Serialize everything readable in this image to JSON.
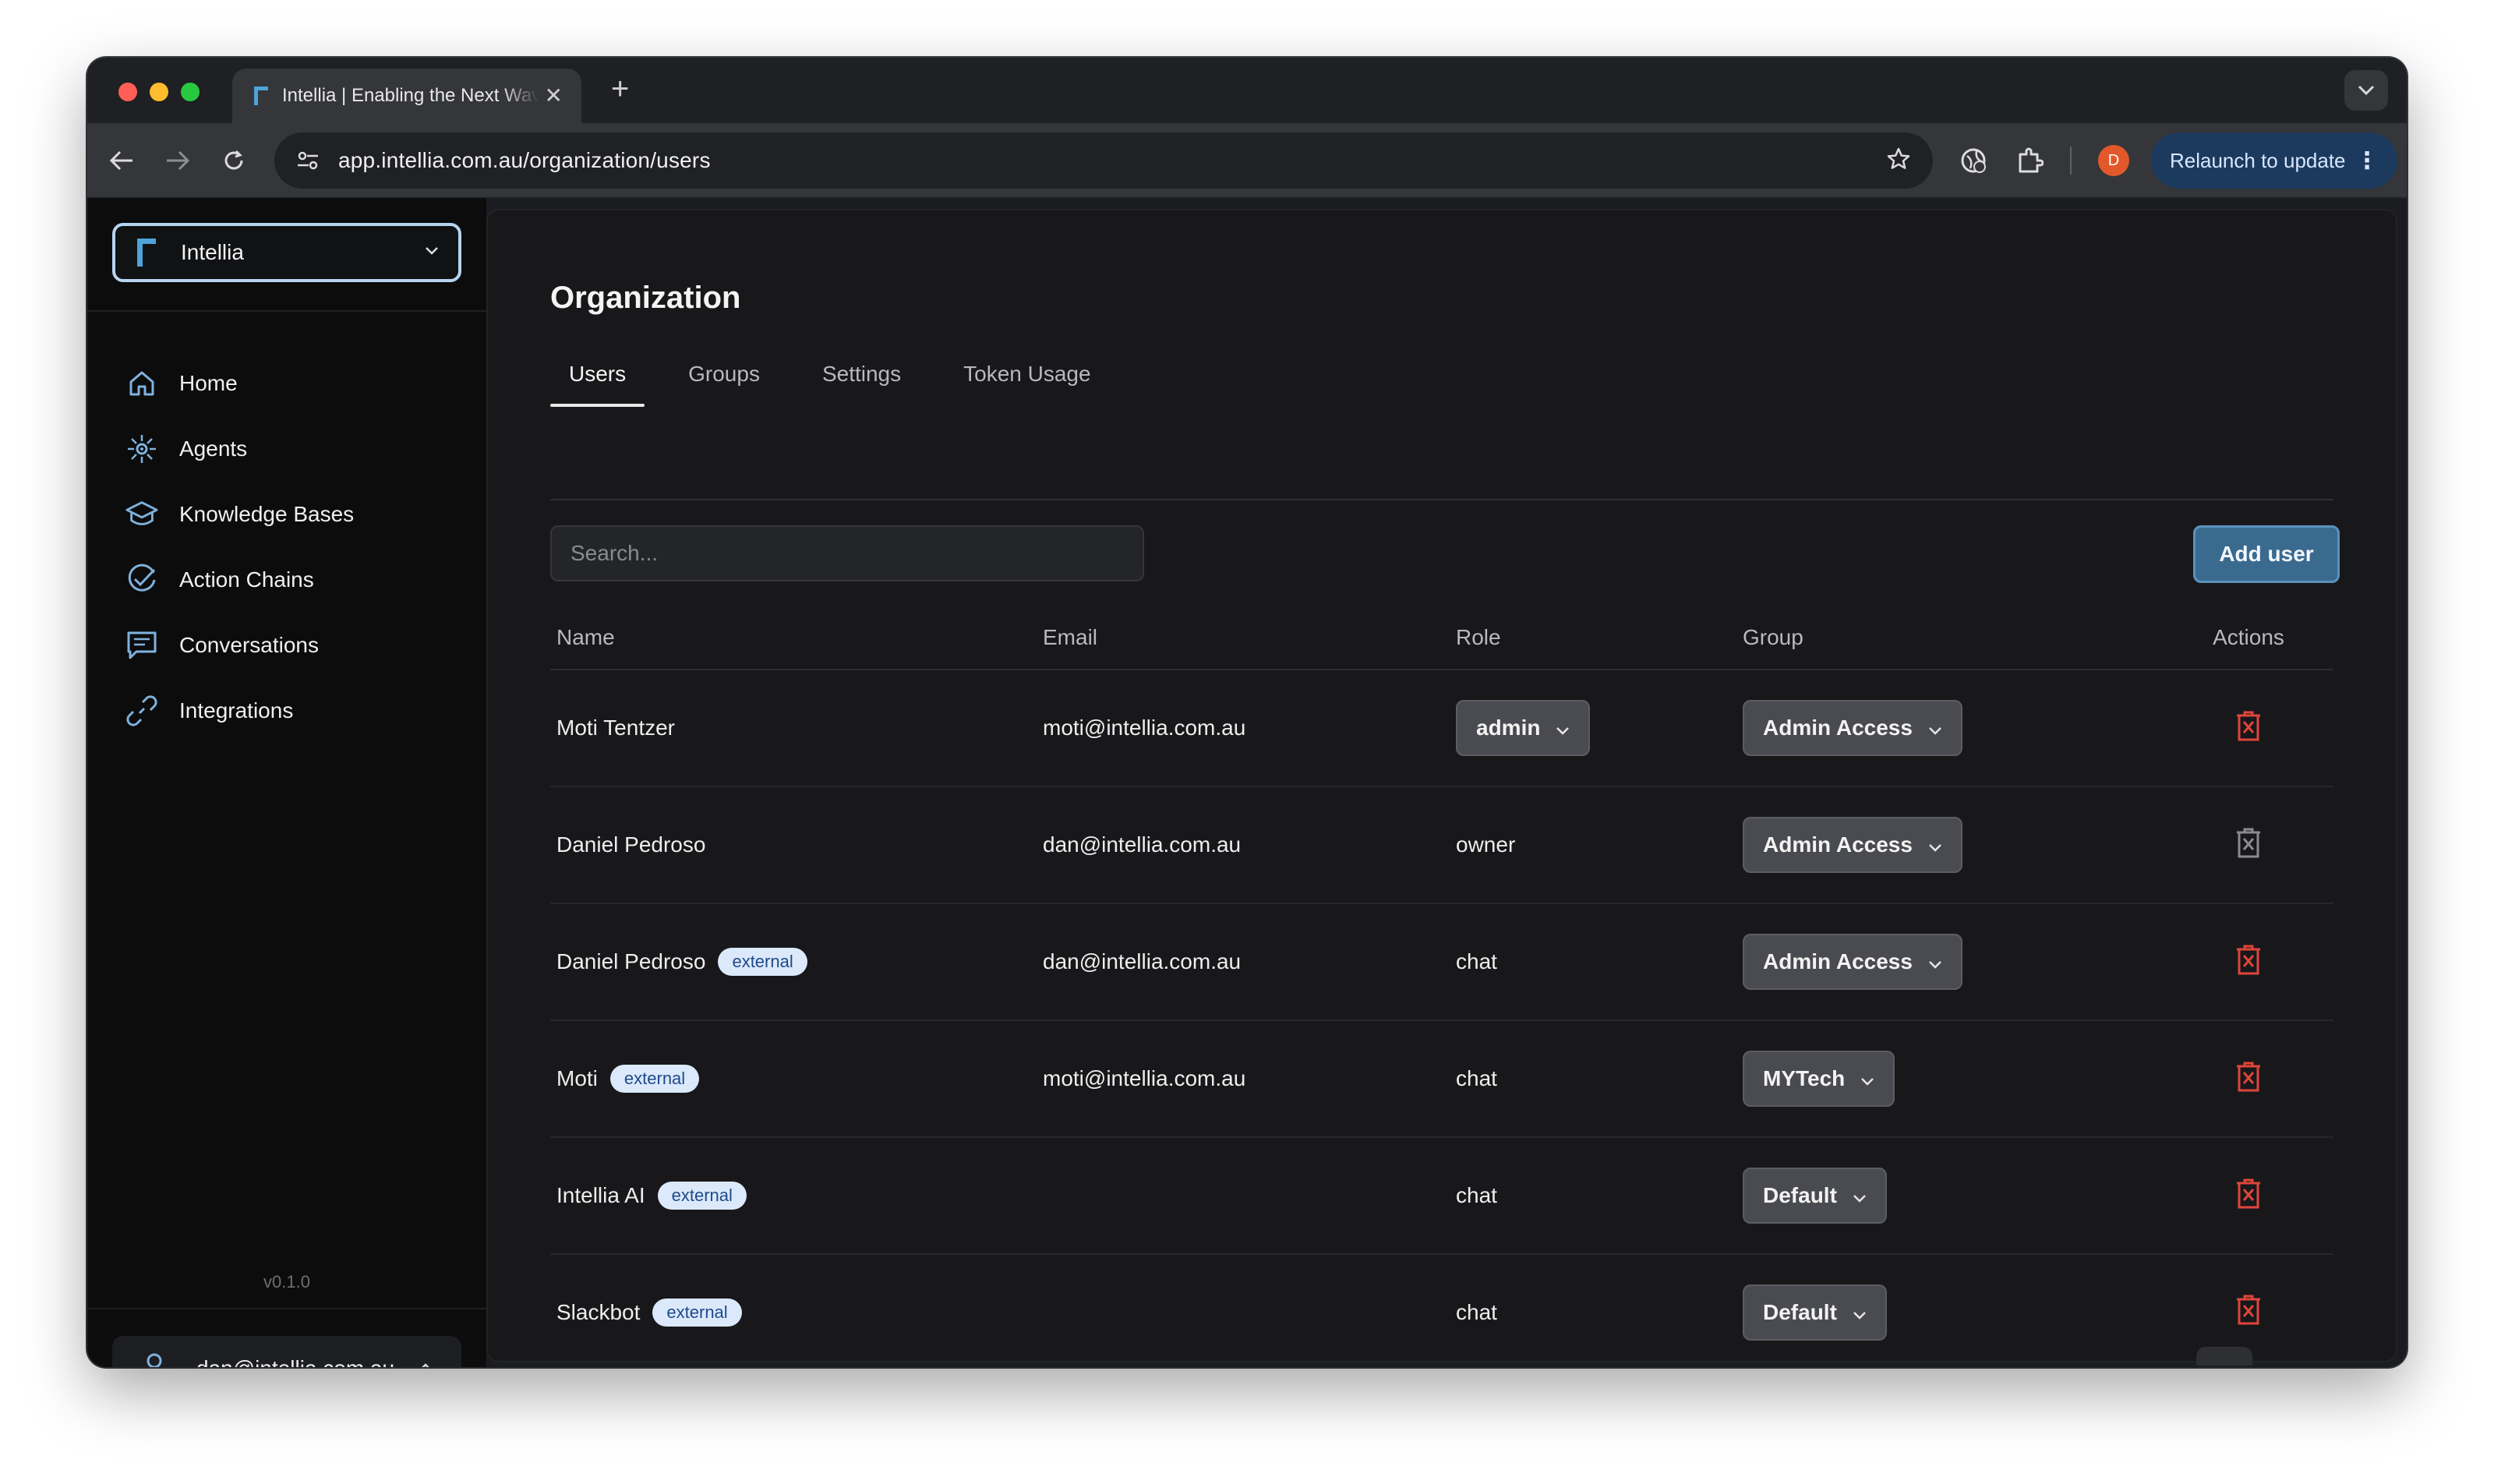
{
  "browser": {
    "tab_title": "Intellia | Enabling the Next Wave",
    "url": "app.intellia.com.au/organization/users",
    "profile_initial": "D",
    "relaunch_label": "Relaunch to update"
  },
  "sidebar": {
    "org_name": "Intellia",
    "items": [
      {
        "label": "Home",
        "icon": "home-icon"
      },
      {
        "label": "Agents",
        "icon": "agents-icon"
      },
      {
        "label": "Knowledge Bases",
        "icon": "knowledge-bases-icon"
      },
      {
        "label": "Action Chains",
        "icon": "check-circle-icon"
      },
      {
        "label": "Conversations",
        "icon": "chat-icon"
      },
      {
        "label": "Integrations",
        "icon": "link-icon"
      }
    ],
    "version": "v0.1.0",
    "user_email": "dan@intellia.com.au"
  },
  "main": {
    "title": "Organization",
    "tabs": [
      {
        "label": "Users",
        "active": true
      },
      {
        "label": "Groups",
        "active": false
      },
      {
        "label": "Settings",
        "active": false
      },
      {
        "label": "Token Usage",
        "active": false
      }
    ],
    "search_placeholder": "Search...",
    "add_user_label": "Add user",
    "columns": {
      "name": "Name",
      "email": "Email",
      "role": "Role",
      "group": "Group",
      "actions": "Actions"
    },
    "rows": [
      {
        "name": "Moti Tentzer",
        "badge": "",
        "email": "moti@intellia.com.au",
        "role": "admin",
        "role_dropdown": true,
        "group": "Admin Access",
        "delete_enabled": true
      },
      {
        "name": "Daniel Pedroso",
        "badge": "",
        "email": "dan@intellia.com.au",
        "role": "owner",
        "role_dropdown": false,
        "group": "Admin Access",
        "delete_enabled": false
      },
      {
        "name": "Daniel Pedroso",
        "badge": "external",
        "email": "dan@intellia.com.au",
        "role": "chat",
        "role_dropdown": false,
        "group": "Admin Access",
        "delete_enabled": true
      },
      {
        "name": "Moti",
        "badge": "external",
        "email": "moti@intellia.com.au",
        "role": "chat",
        "role_dropdown": false,
        "group": "MYTech",
        "delete_enabled": true
      },
      {
        "name": "Intellia AI",
        "badge": "external",
        "email": "",
        "role": "chat",
        "role_dropdown": false,
        "group": "Default",
        "delete_enabled": true
      },
      {
        "name": "Slackbot",
        "badge": "external",
        "email": "",
        "role": "chat",
        "role_dropdown": false,
        "group": "Default",
        "delete_enabled": true
      }
    ]
  },
  "colors": {
    "accent": "#3b6a8f",
    "delete_active": "#e0453a",
    "delete_disabled": "#8a8b90",
    "badge_bg": "#dbe9fb",
    "badge_text": "#1f4a8a"
  }
}
